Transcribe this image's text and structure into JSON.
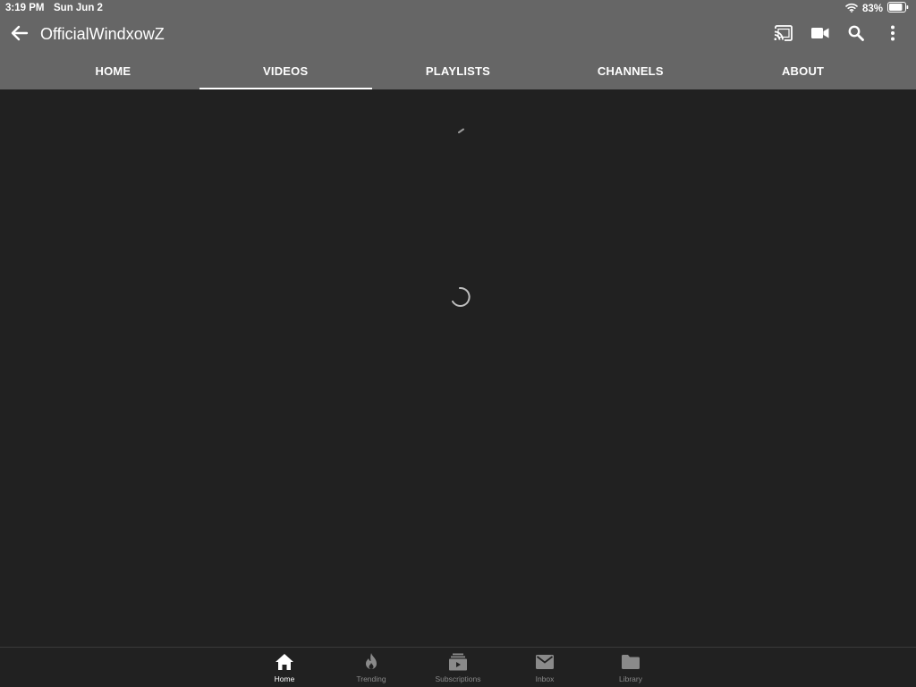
{
  "status": {
    "time": "3:19 PM",
    "date": "Sun Jun 2",
    "battery_percent": "83%",
    "icons": [
      "wifi-icon",
      "battery-icon"
    ]
  },
  "appbar": {
    "title": "OfficialWindxowZ",
    "back_icon": "arrow-left-icon",
    "actions": [
      "cast-icon",
      "video-camera-icon",
      "search-icon",
      "more-vertical-icon"
    ]
  },
  "tabs": [
    {
      "label": "HOME",
      "active": false
    },
    {
      "label": "VIDEOS",
      "active": true
    },
    {
      "label": "PLAYLISTS",
      "active": false
    },
    {
      "label": "CHANNELS",
      "active": false
    },
    {
      "label": "ABOUT",
      "active": false
    }
  ],
  "content": {
    "state": "loading",
    "icons": [
      "loading-spinner-icon"
    ]
  },
  "bottom_nav": [
    {
      "label": "Home",
      "icon": "home-icon",
      "active": true
    },
    {
      "label": "Trending",
      "icon": "flame-icon",
      "active": false
    },
    {
      "label": "Subscriptions",
      "icon": "subscriptions-icon",
      "active": false
    },
    {
      "label": "Inbox",
      "icon": "mail-icon",
      "active": false
    },
    {
      "label": "Library",
      "icon": "folder-icon",
      "active": false
    }
  ],
  "colors": {
    "header": "#666666",
    "background": "#212121",
    "active": "#ffffff",
    "inactive": "#8a8a8a"
  }
}
